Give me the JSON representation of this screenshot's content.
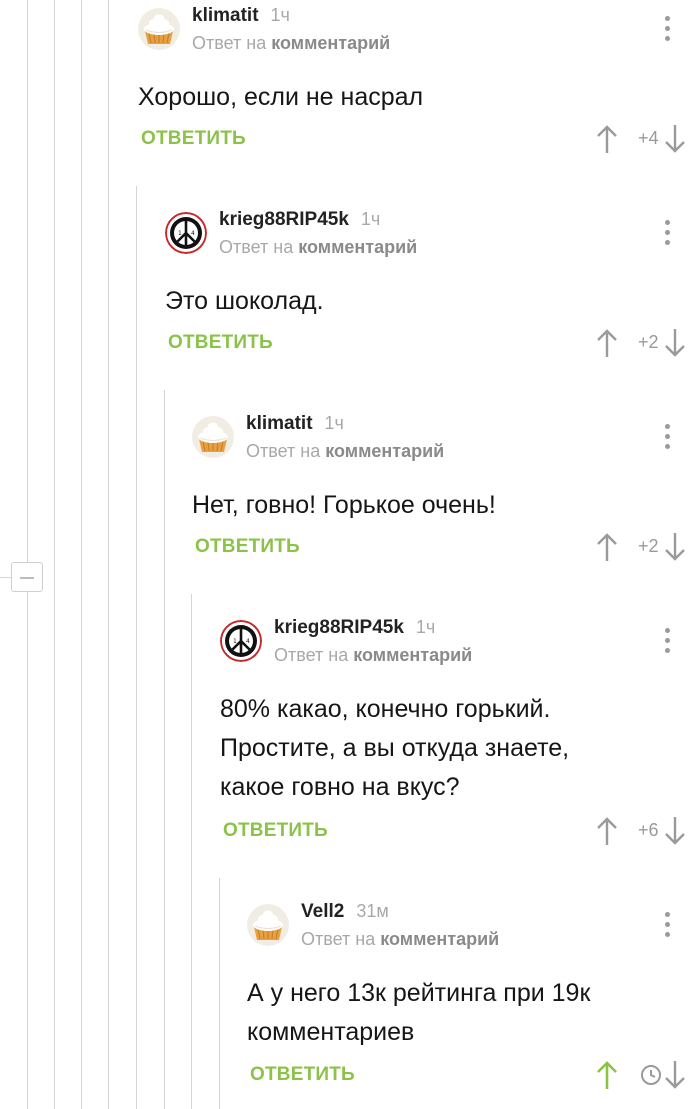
{
  "common": {
    "reply_to_prefix": "Ответ на",
    "reply_to_target": "комментарий",
    "reply_button": "ОТВЕТИТЬ"
  },
  "comments": [
    {
      "author": "klimatit",
      "time": "1ч",
      "avatar": "cupcake-avatar",
      "text": [
        "Хорошо, если не насрал"
      ],
      "rating": "+4"
    },
    {
      "author": "krieg88RIP45k",
      "time": "1ч",
      "avatar": "peace-sign-avatar",
      "text": [
        "Это шоколад."
      ],
      "rating": "+2"
    },
    {
      "author": "klimatit",
      "time": "1ч",
      "avatar": "cupcake-avatar",
      "text": [
        "Нет, говно! Горькое очень!"
      ],
      "rating": "+2"
    },
    {
      "author": "krieg88RIP45k",
      "time": "1ч",
      "avatar": "peace-sign-avatar",
      "text": [
        "80% какао, конечно горький.",
        "Простите, а вы откуда знаете,",
        "какое говно на вкус?"
      ],
      "rating": "+6"
    },
    {
      "author": "Vell2",
      "time": "31м",
      "avatar": "cupcake-avatar",
      "text": [
        "А у него 13к рейтинга при 19к",
        "комментариев"
      ],
      "rating_hidden_icon": "clock-icon",
      "upvoted": true
    }
  ],
  "colors": {
    "accent_green": "#8bc34a",
    "muted_text": "#a8a8a8",
    "thread_line": "#d6d6d6"
  }
}
